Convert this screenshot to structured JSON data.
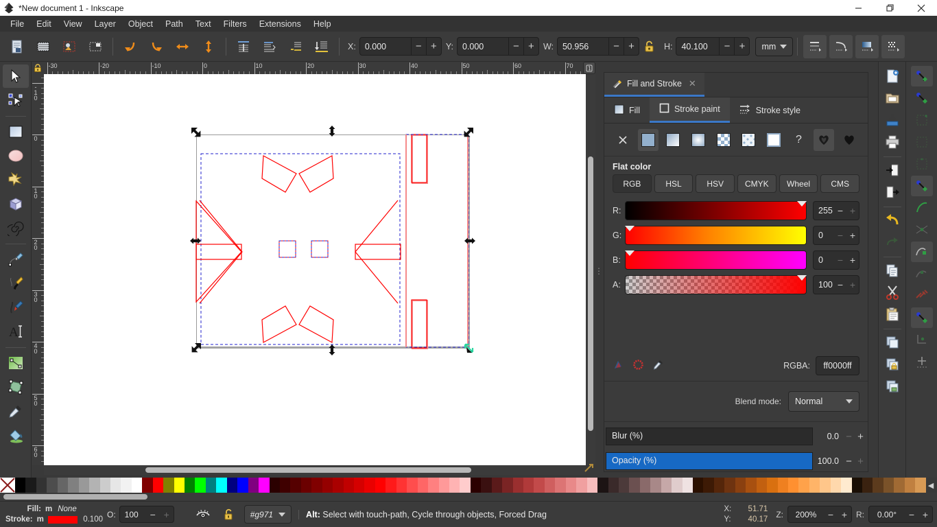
{
  "window": {
    "title": "*New document 1 - Inkscape",
    "icon": "inkscape-logo-icon",
    "minimize": "minimize-button",
    "maximize": "restore-button",
    "close": "close-button"
  },
  "menu": {
    "items": [
      "File",
      "Edit",
      "View",
      "Layer",
      "Object",
      "Path",
      "Text",
      "Filters",
      "Extensions",
      "Help"
    ]
  },
  "command_toolbar": {
    "buttons": [
      {
        "name": "new-document-icon"
      },
      {
        "name": "duplicate-icon"
      },
      {
        "name": "import-image-icon"
      },
      {
        "name": "select-all-icon"
      },
      {
        "name": "undo-icon"
      },
      {
        "name": "redo-icon"
      },
      {
        "name": "flip-horizontal-icon"
      },
      {
        "name": "flip-vertical-icon"
      },
      {
        "name": "raise-to-top-icon"
      },
      {
        "name": "raise-icon"
      },
      {
        "name": "lower-icon"
      },
      {
        "name": "lower-to-bottom-icon"
      }
    ],
    "x": {
      "label": "X:",
      "value": "0.000"
    },
    "y": {
      "label": "Y:",
      "value": "0.000"
    },
    "w": {
      "label": "W:",
      "value": "50.956"
    },
    "h": {
      "label": "H:",
      "value": "40.100"
    },
    "lock_ratio": "lock-icon",
    "unit": "mm",
    "transform_buttons": [
      {
        "name": "affect-stroke-width-icon"
      },
      {
        "name": "affect-rounded-corners-icon"
      },
      {
        "name": "affect-gradients-icon"
      },
      {
        "name": "affect-patterns-icon"
      }
    ]
  },
  "toolbox": {
    "tools": [
      {
        "name": "selector-tool",
        "icon": "arrow-cursor-icon",
        "active": true
      },
      {
        "name": "node-tool",
        "icon": "node-editor-icon",
        "active": false
      },
      {
        "name": "rectangle-tool",
        "icon": "rectangle-icon",
        "active": false
      },
      {
        "name": "ellipse-tool",
        "icon": "ellipse-icon",
        "active": false
      },
      {
        "name": "star-tool",
        "icon": "star-icon",
        "active": false
      },
      {
        "name": "box3d-tool",
        "icon": "cube-icon",
        "active": false
      },
      {
        "name": "spiral-tool",
        "icon": "spiral-icon",
        "active": false
      },
      {
        "name": "pencil-tool",
        "icon": "pencil-icon",
        "active": false
      },
      {
        "name": "bezier-tool",
        "icon": "pen-icon",
        "active": false
      },
      {
        "name": "calligraphy-tool",
        "icon": "calligraphy-pen-icon",
        "active": false
      },
      {
        "name": "text-tool",
        "icon": "text-a-icon",
        "active": false
      },
      {
        "name": "gradient-tool",
        "icon": "gradient-icon",
        "active": false
      },
      {
        "name": "mesh-tool",
        "icon": "mesh-gradient-icon",
        "active": false
      },
      {
        "name": "dropper-tool",
        "icon": "eyedropper-icon",
        "active": false
      },
      {
        "name": "paint-bucket-tool",
        "icon": "paint-bucket-icon",
        "active": false
      }
    ]
  },
  "rulers": {
    "horizontal_labels": [
      "30",
      "-20",
      "-10",
      "0",
      "10",
      "20",
      "20",
      "30",
      "40",
      "50",
      "60",
      "70"
    ],
    "horizontal_values": [
      -30,
      -20,
      -10,
      0,
      10,
      20,
      30,
      40,
      50,
      60,
      70
    ],
    "vertical_values": [
      -10,
      0,
      10,
      20,
      30,
      40,
      50,
      60
    ],
    "lock_icon": "ruler-lock-icon",
    "guide_button": "guides-lock-icon"
  },
  "canvas": {
    "page_label": "drawing-page",
    "stroke_color": "#ff0000",
    "selection_box_color": "#2222cc",
    "objects": [
      "arrow-triangle-left",
      "arrow-triangle-right",
      "corner-bar-top-left",
      "corner-bar-top-right",
      "corner-bar-bottom-left",
      "corner-bar-bottom-right",
      "bar-left",
      "bar-right",
      "small-square-left",
      "small-square-right",
      "side-bar-top",
      "side-bar-bottom"
    ]
  },
  "dialog": {
    "tab_title": "Fill and Stroke",
    "tab_icon": "fill-stroke-icon",
    "close_icon": "close-icon",
    "subtabs": [
      {
        "label": "Fill",
        "icon": "fill-swatch-icon",
        "active": false
      },
      {
        "label": "Stroke paint",
        "icon": "stroke-swatch-icon",
        "active": true
      },
      {
        "label": "Stroke style",
        "icon": "stroke-style-icon",
        "active": false
      }
    ],
    "paint_types": [
      {
        "name": "no-paint-button",
        "icon": "x-icon",
        "selected": false
      },
      {
        "name": "flat-color-button",
        "icon": "flat-color-icon",
        "selected": true
      },
      {
        "name": "linear-gradient-button",
        "icon": "linear-gradient-icon",
        "selected": false
      },
      {
        "name": "radial-gradient-button",
        "icon": "radial-gradient-icon",
        "selected": false
      },
      {
        "name": "pattern-button",
        "icon": "pattern-icon",
        "selected": false
      },
      {
        "name": "swatch-button",
        "icon": "swatch-icon",
        "selected": false
      },
      {
        "name": "unknown-paint-button",
        "icon": "unset-paint-icon",
        "selected": false
      },
      {
        "name": "question-button",
        "icon": "question-mark-icon",
        "selected": false
      },
      {
        "name": "even-odd-fillrule-button",
        "icon": "fill-rule-evenodd-icon",
        "selected": true
      },
      {
        "name": "nonzero-fillrule-button",
        "icon": "fill-rule-nonzero-icon",
        "selected": false
      }
    ],
    "flat_color_label": "Flat color",
    "color_modes": [
      {
        "label": "RGB",
        "active": true
      },
      {
        "label": "HSL",
        "active": false
      },
      {
        "label": "HSV",
        "active": false
      },
      {
        "label": "CMYK",
        "active": false
      },
      {
        "label": "Wheel",
        "active": false
      },
      {
        "label": "CMS",
        "active": false
      }
    ],
    "channels": [
      {
        "label": "R:",
        "value": "255",
        "percent": 100,
        "minus_enabled": true,
        "plus_enabled": false
      },
      {
        "label": "G:",
        "value": "0",
        "percent": 0,
        "minus_enabled": false,
        "plus_enabled": true
      },
      {
        "label": "B:",
        "value": "0",
        "percent": 0,
        "minus_enabled": false,
        "plus_enabled": true
      },
      {
        "label": "A:",
        "value": "100",
        "percent": 100,
        "minus_enabled": true,
        "plus_enabled": false
      }
    ],
    "footer_icons": [
      "pick-color-icon",
      "color-managed-icon",
      "eyedropper-icon"
    ],
    "rgba_label": "RGBA:",
    "rgba_value": "ff0000ff",
    "blend_mode_label": "Blend mode:",
    "blend_mode_value": "Normal",
    "blur": {
      "label": "Blur (%)",
      "value": "0.0",
      "percent": 0
    },
    "opacity": {
      "label": "Opacity (%)",
      "value": "100.0",
      "percent": 100
    }
  },
  "right_toolbar": {
    "buttons": [
      {
        "name": "new-file-icon"
      },
      {
        "name": "open-file-icon"
      },
      {
        "name": "save-file-icon"
      },
      {
        "name": "print-icon"
      },
      {
        "name": "import-icon"
      },
      {
        "name": "export-icon"
      },
      {
        "name": "undo-icon"
      },
      {
        "name": "redo-icon"
      },
      {
        "name": "copy-icon"
      },
      {
        "name": "cut-icon"
      },
      {
        "name": "paste-icon"
      },
      {
        "name": "duplicate-icon"
      },
      {
        "name": "lock-object-icon"
      },
      {
        "name": "clone-icon"
      }
    ]
  },
  "snap_toolbar": {
    "buttons": [
      {
        "name": "enable-snapping-icon",
        "active": true
      },
      {
        "name": "snap-bounding-box-icon",
        "active": false
      },
      {
        "name": "snap-bbox-corners-icon",
        "active": false
      },
      {
        "name": "snap-bbox-edges-icon",
        "active": false
      },
      {
        "name": "snap-bbox-midpoints-icon",
        "active": false
      },
      {
        "name": "snap-nodes-icon",
        "active": true
      },
      {
        "name": "snap-paths-icon",
        "active": false
      },
      {
        "name": "snap-path-intersections-icon",
        "active": false
      },
      {
        "name": "snap-cusp-nodes-icon",
        "active": true
      },
      {
        "name": "snap-smooth-nodes-icon",
        "active": false
      },
      {
        "name": "snap-midpoints-icon",
        "active": false
      },
      {
        "name": "snap-centers-icon",
        "active": true
      },
      {
        "name": "snap-object-rotation-icon",
        "active": false
      },
      {
        "name": "snap-grid-icon",
        "active": false
      }
    ]
  },
  "palette": {
    "none_swatch": "none-swatch",
    "colors": [
      "#000000",
      "#1a1a1a",
      "#333333",
      "#4d4d4d",
      "#666666",
      "#808080",
      "#999999",
      "#b3b3b3",
      "#cccccc",
      "#e6e6e6",
      "#f2f2f2",
      "#ffffff",
      "#800000",
      "#ff0000",
      "#808000",
      "#ffff00",
      "#008000",
      "#00ff00",
      "#008080",
      "#00ffff",
      "#000080",
      "#0000ff",
      "#800080",
      "#ff00ff",
      "#2b0000",
      "#3f0000",
      "#550000",
      "#6b0000",
      "#800000",
      "#950000",
      "#aa0000",
      "#c00000",
      "#d50000",
      "#ea0000",
      "#ff0000",
      "#ff1a1a",
      "#ff3333",
      "#ff4d4d",
      "#ff6666",
      "#ff8080",
      "#ff9999",
      "#ffb3b3",
      "#ffcccc",
      "#2b0000",
      "#3a1010",
      "#5a1a1a",
      "#7a2424",
      "#9a2f2f",
      "#b03a3a",
      "#c24a4a",
      "#cf5f5f",
      "#dc7474",
      "#e88989",
      "#f0a0a0",
      "#f7bdbd",
      "#1c1414",
      "#3a2a2a",
      "#4c3a3a",
      "#6b5050",
      "#8a6a6a",
      "#a88888",
      "#c6a8a8",
      "#e0cccc",
      "#efe2e2",
      "#2b1000",
      "#3d1a05",
      "#55260a",
      "#6e3310",
      "#8a4010",
      "#a85010",
      "#c26010",
      "#d97010",
      "#ef8020",
      "#ff9030",
      "#ffa24a",
      "#ffb468",
      "#ffc68a",
      "#ffd8ac",
      "#ffeacf",
      "#1a0f05",
      "#3a2210",
      "#5c3b1d",
      "#7a5229",
      "#a06a34",
      "#c08040",
      "#d89a55"
    ]
  },
  "status": {
    "fill_label": "Fill:",
    "fill_marker": "m",
    "fill_value": "None",
    "stroke_label": "Stroke:",
    "stroke_marker": "m",
    "stroke_color": "#ff0000",
    "stroke_width": "0.100",
    "opacity_label": "O:",
    "opacity_value": "100",
    "visibility_icon": "eye-icon",
    "lock_icon": "unlocked-icon",
    "layer_value": "#g971",
    "message_key": "Alt:",
    "message_text": "Select with touch-path, Cycle through objects, Forced Drag",
    "cursor_x_label": "X:",
    "cursor_x": "51.71",
    "cursor_y_label": "Y:",
    "cursor_y": "40.17",
    "zoom_label": "Z:",
    "zoom_value": "200%",
    "rotation_label": "R:",
    "rotation_value": "0.00°"
  }
}
